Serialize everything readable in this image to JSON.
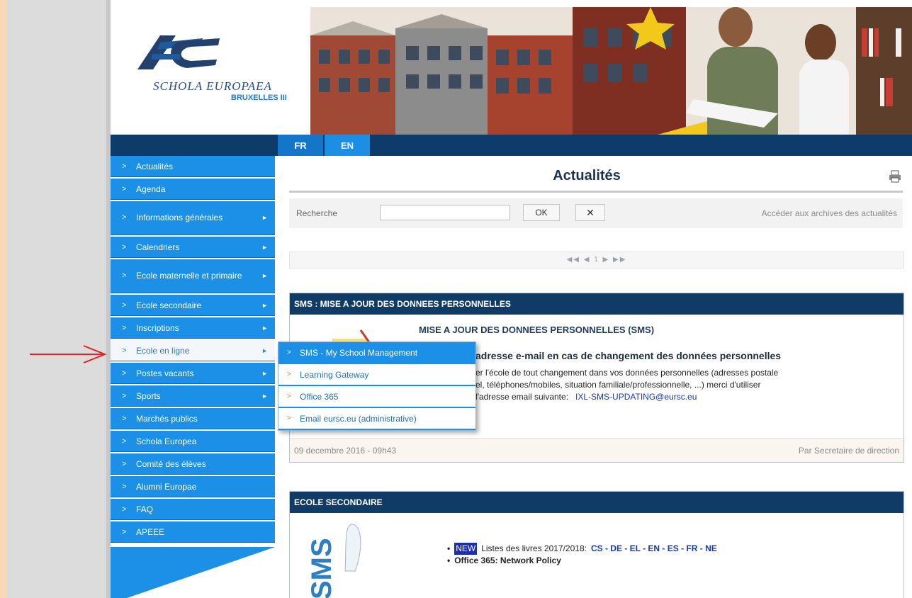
{
  "header": {
    "logo_text": "SCHOLA EUROPAEA",
    "logo_subtitle": "BRUXELLES III",
    "languages": [
      "FR",
      "EN"
    ]
  },
  "sidebar": {
    "items": [
      {
        "label": "Actualités",
        "submenu": false
      },
      {
        "label": "Agenda",
        "submenu": false
      },
      {
        "label": "Informations générales",
        "submenu": true
      },
      {
        "label": "Calendriers",
        "submenu": true
      },
      {
        "label": "Ecole maternelle et primaire",
        "submenu": true
      },
      {
        "label": "Ecole secondaire",
        "submenu": true
      },
      {
        "label": "Inscriptions",
        "submenu": true
      },
      {
        "label": "Ecole en ligne",
        "submenu": true,
        "active": true
      },
      {
        "label": "Postes vacants",
        "submenu": true
      },
      {
        "label": "Sports",
        "submenu": true
      },
      {
        "label": "Marchés publics",
        "submenu": false
      },
      {
        "label": "Schola Europea",
        "submenu": false
      },
      {
        "label": "Comité des élèves",
        "submenu": false
      },
      {
        "label": "Alumni Europae",
        "submenu": false
      },
      {
        "label": "FAQ",
        "submenu": false
      },
      {
        "label": "APEEE",
        "submenu": false
      }
    ]
  },
  "flyout": {
    "items": [
      {
        "label": "SMS - My School Management",
        "highlighted": true
      },
      {
        "label": "Learning Gateway",
        "highlighted": false
      },
      {
        "label": "Office 365",
        "highlighted": false
      },
      {
        "label": "Email eursc.eu (administrative)",
        "highlighted": false
      }
    ]
  },
  "main": {
    "title": "Actualités",
    "search": {
      "label": "Recherche",
      "value": "",
      "ok_label": "OK",
      "clear_label": "✕",
      "archives_link": "Accéder aux archives des actualités"
    },
    "pager": "◀◀ ◀ 1 ▶ ▶▶"
  },
  "articles": [
    {
      "header": "SMS : MISE A JOUR DES DONNEES PERSONNELLES",
      "title": "MISE A JOUR DES DONNEES PERSONNELLES (SMS)",
      "subtitle": "adresse e-mail en cas de changement des données personnelles",
      "body_line1": "er l'école de tout changement dans vos données personnelles (adresses postale",
      "body_line2": "el, téléphones/mobiles, situation familiale/professionnelle, ...) merci d'utiliser",
      "body_line3": "l'adresse email suivante:",
      "email": "IXL-SMS-UPDATING@eursc.eu",
      "date": "09 decembre 2016 - 09h43",
      "author": "Par Secretaire de direction"
    },
    {
      "header": "ECOLE SECONDAIRE",
      "badge": "NEW",
      "list_item1_text": "Listes des livres 2017/2018:",
      "list_item1_links": "CS - DE - EL - EN - ES - FR - NE",
      "list_item2": "Office 365: Network Policy",
      "image_text": "SMS"
    }
  ],
  "colors": {
    "nav_blue": "#1c8fe6",
    "dark_navy": "#0f3b66",
    "active_text": "#2c78c6",
    "background": "#f7d9b8",
    "arrow_red": "#e02424"
  }
}
